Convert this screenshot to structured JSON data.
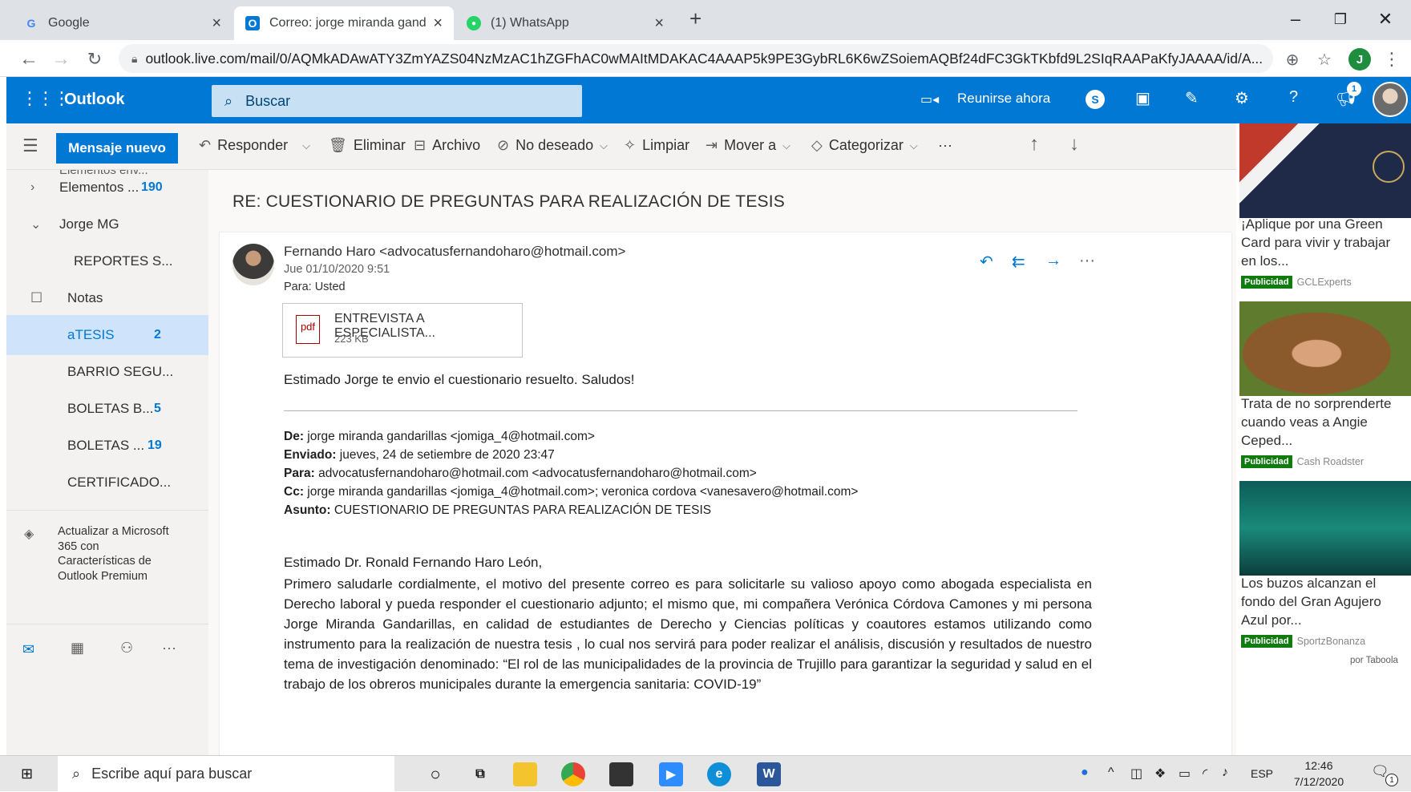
{
  "browser": {
    "tabs": [
      {
        "title": "Google",
        "favicon": "G"
      },
      {
        "title": "Correo: jorge miranda gandarilla",
        "favicon": "O"
      },
      {
        "title": "(1) WhatsApp",
        "favicon": "W"
      }
    ],
    "url": "outlook.live.com/mail/0/AQMkADAwATY3ZmYAZS04NzMzAC1hZGFhAC0wMAItMDAKAC4AAAP5k9PE3GybRL6K6wZSoiemAQBf24dFC3GkTKbfd9L2SIqRAAPaKfyJAAAA/id/A...",
    "profile_initial": "J"
  },
  "outlook": {
    "app_name": "Outlook",
    "search_placeholder": "Buscar",
    "meet_now": "Reunirse ahora",
    "notification_count": "1"
  },
  "commands": {
    "new_message": "Mensaje nuevo",
    "reply": "Responder",
    "delete": "Eliminar",
    "archive": "Archivo",
    "junk": "No deseado",
    "sweep": "Limpiar",
    "move_to": "Mover a",
    "categorize": "Categorizar",
    "more": "···"
  },
  "folders": [
    {
      "label": "Elementos ...",
      "count": "190",
      "chevron": "›"
    },
    {
      "label": "Jorge MG",
      "count": "",
      "chevron": "⌄"
    },
    {
      "label": "REPORTES S...",
      "count": ""
    },
    {
      "label": "Notas",
      "count": ""
    },
    {
      "label": "aTESIS",
      "count": "2"
    },
    {
      "label": "BARRIO SEGU...",
      "count": ""
    },
    {
      "label": "BOLETAS B...",
      "count": "5"
    },
    {
      "label": "BOLETAS ...",
      "count": "19"
    },
    {
      "label": "CERTIFICADO...",
      "count": ""
    }
  ],
  "upgrade": {
    "text": "Actualizar a Microsoft 365 con Características de Outlook Premium"
  },
  "email": {
    "subject": "RE: CUESTIONARIO DE PREGUNTAS PARA REALIZACIÓN DE TESIS",
    "sender": "Fernando Haro <advocatusfernandoharo@hotmail.com>",
    "date": "Jue 01/10/2020 9:51",
    "to_label": "Para:",
    "to": "Usted",
    "attachment": {
      "name": "ENTREVISTA A ESPECIALISTA...",
      "size": "223 KB",
      "type": "pdf"
    },
    "body_first": "Estimado Jorge te envio el cuestionario resuelto. Saludos!",
    "forward": {
      "from_label": "De:",
      "from": "jorge miranda gandarillas <jomiga_4@hotmail.com>",
      "sent_label": "Enviado:",
      "sent": "jueves, 24 de setiembre de 2020 23:47",
      "to_label": "Para:",
      "to": "advocatusfernandoharo@hotmail.com <advocatusfernandoharo@hotmail.com>",
      "cc_label": "Cc:",
      "cc": "jorge miranda gandarillas <jomiga_4@hotmail.com>; veronica cordova <vanesavero@hotmail.com>",
      "subject_label": "Asunto:",
      "subject": "CUESTIONARIO DE PREGUNTAS PARA REALIZACIÓN DE TESIS"
    },
    "greeting": "Estimado Dr. Ronald Fernando Haro León,",
    "paragraph": "Primero saludarle cordialmente, el motivo del presente correo es para solicitarle su valioso apoyo como abogada especialista en Derecho laboral y pueda responder el cuestionario adjunto; el mismo que, mi compañera Verónica Córdova Camones y mi persona Jorge Miranda Gandarillas, en calidad de estudiantes de Derecho y Ciencias políticas y coautores estamos utilizando como instrumento para la realización de nuestra tesis , lo cual nos servirá para poder realizar el análisis, discusión y resultados de nuestro tema de investigación denominado: “El rol de las municipalidades de la provincia de Trujillo para garantizar la seguridad y salud en el trabajo de los obreros municipales durante la emergencia sanitaria: COVID-19”"
  },
  "ads": [
    {
      "text": "¡Aplique por una Green Card para vivir y trabajar en los...",
      "tag": "Publicidad",
      "source": "GCLExperts"
    },
    {
      "text": "Trata de no sorprenderte cuando veas a Angie Ceped...",
      "tag": "Publicidad",
      "source": "Cash Roadster"
    },
    {
      "text": "Los buzos alcanzan el fondo del Gran Agujero Azul por...",
      "tag": "Publicidad",
      "source": "SportzBonanza"
    }
  ],
  "ads_footer": "por Taboola",
  "taskbar": {
    "search_placeholder": "Escribe aquí para buscar",
    "language": "ESP",
    "time": "12:46",
    "date": "7/12/2020",
    "notifications": "1"
  },
  "colors": {
    "outlook_blue": "#0078d4",
    "selected_folder": "#cfe4fa",
    "ad_tag": "#107c10"
  }
}
